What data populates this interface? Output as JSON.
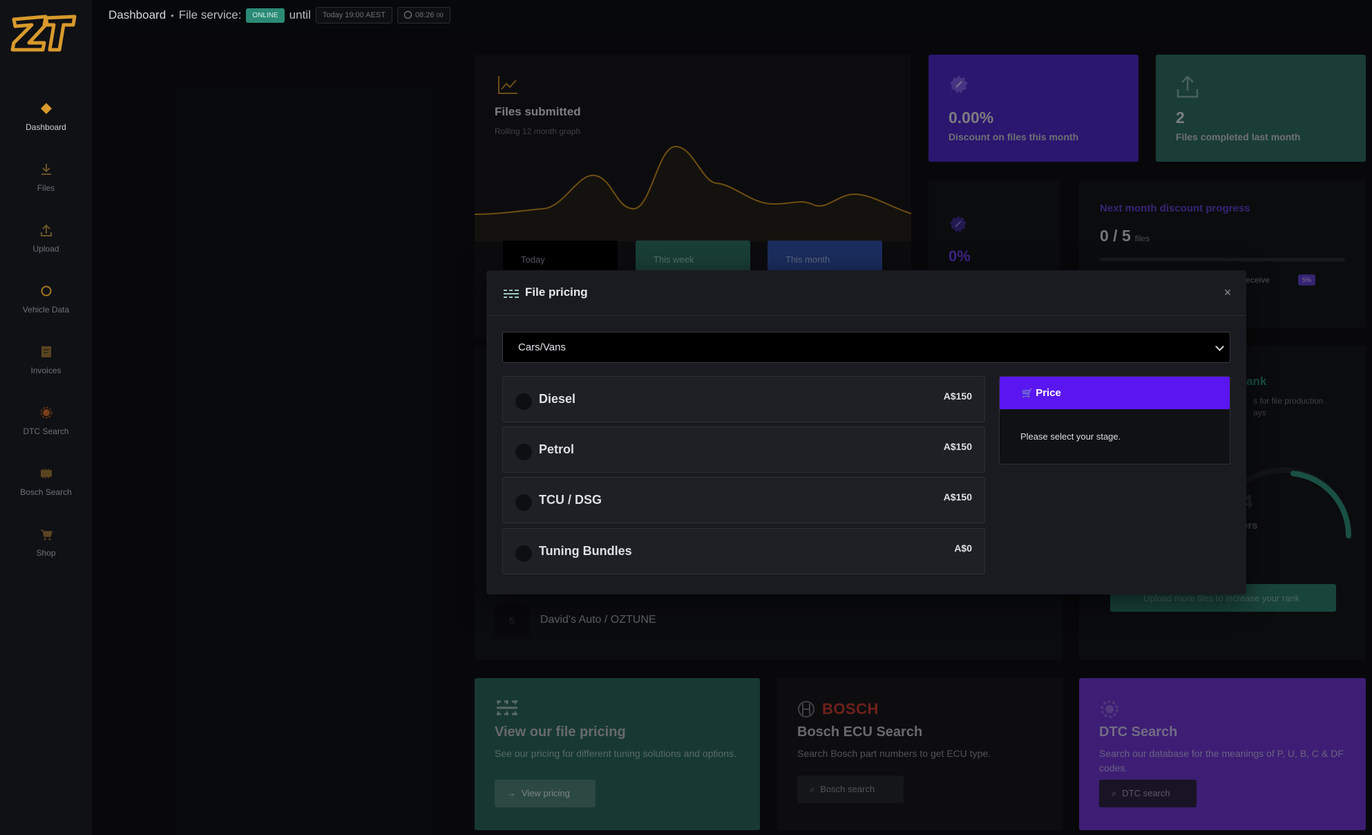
{
  "sidebar": {
    "items": [
      {
        "label": "Dashboard",
        "icon": "diamond-icon",
        "active": true
      },
      {
        "label": "Files",
        "icon": "download-icon"
      },
      {
        "label": "Upload",
        "icon": "upload-icon"
      },
      {
        "label": "Vehicle Data",
        "icon": "circle-icon"
      },
      {
        "label": "Invoices",
        "icon": "invoice-icon"
      },
      {
        "label": "DTC Search",
        "icon": "gear-icon"
      },
      {
        "label": "Bosch Search",
        "icon": "ecu-icon"
      },
      {
        "label": "Shop",
        "icon": "cart-icon"
      }
    ]
  },
  "topbar": {
    "title": "Dashboard",
    "separator": "•",
    "service_label": "File service:",
    "status": "ONLINE",
    "until": "until",
    "until_time": "Today 19:00 AEST",
    "clock": "08:26",
    "clock_seconds": "00"
  },
  "files_card": {
    "title": "Files submitted",
    "subtitle": "Rolling 12 month graph",
    "periods": [
      "Today",
      "This week",
      "This month"
    ]
  },
  "stats": {
    "discount_value": "0.00%",
    "discount_label": "Discount on files this month",
    "completed_value": "2",
    "completed_label": "Files completed last month",
    "small_value": "0%"
  },
  "progress": {
    "title": "Next month discount progress",
    "count": "0 / 5",
    "unit": "files",
    "fraction": 0,
    "reach_text": "h to receive",
    "reach_pct": "5%"
  },
  "leaderboard": {
    "rank": "5",
    "name": "David's Auto / OZTUNE"
  },
  "rank_card": {
    "title": "ank",
    "desc_line1": "s for file production",
    "desc_line2": "ays",
    "number": "4",
    "users": "ers",
    "button": "Upload more files to increase your rank"
  },
  "promos": {
    "pricing": {
      "title": "View our file pricing",
      "text": "See our pricing for different tuning solutions and options.",
      "button": "View pricing"
    },
    "bosch": {
      "brand": "BOSCH",
      "title": "Bosch ECU Search",
      "text": "Search Bosch part numbers to get ECU type.",
      "button": "Bosch search"
    },
    "dtc": {
      "title": "DTC Search",
      "text": "Search our database for the meanings of P, U, B, C & DF codes.",
      "button": "DTC search"
    }
  },
  "modal": {
    "title": "File pricing",
    "close": "×",
    "category_selected": "Cars/Vans",
    "options": [
      {
        "name": "Diesel",
        "price": "A$150"
      },
      {
        "name": "Petrol",
        "price": "A$150"
      },
      {
        "name": "TCU / DSG",
        "price": "A$150"
      },
      {
        "name": "Tuning Bundles",
        "price": "A$0"
      }
    ],
    "price_header": "Price",
    "price_body": "Please select your stage."
  },
  "colors": {
    "accent_gold": "#d89a2c",
    "online_green": "#2b8a76",
    "purple": "#5a16f0",
    "teal": "#2d6a61"
  }
}
